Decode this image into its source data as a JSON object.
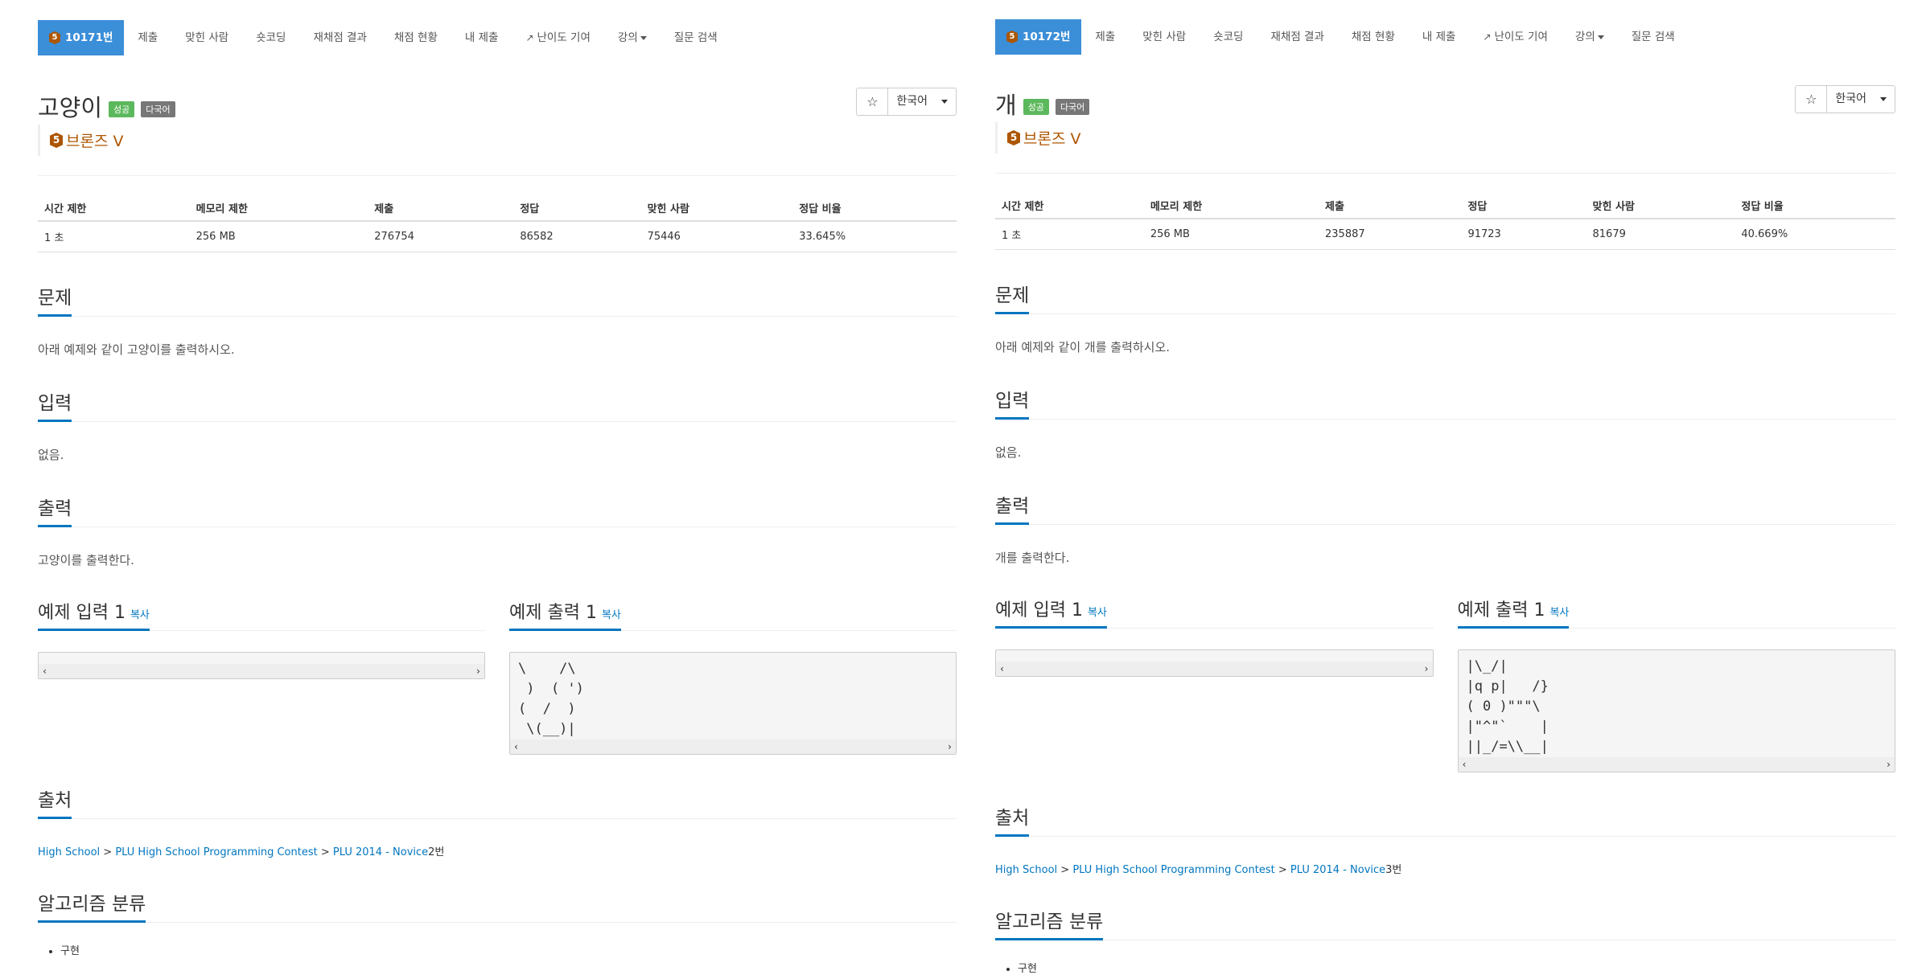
{
  "panels": [
    {
      "nav": {
        "problem_id": "10171번",
        "tier_digit": "5",
        "items": [
          "제출",
          "맞힌 사람",
          "숏코딩",
          "재채점 결과",
          "채점 현황",
          "내 제출",
          "난이도 기여",
          "강의",
          "질문 검색"
        ]
      },
      "title": "고양이",
      "badges": [
        "성공",
        "다국어"
      ],
      "star": "☆",
      "language": "한국어",
      "tier": "브론즈 V",
      "table": {
        "headers": [
          "시간 제한",
          "메모리 제한",
          "제출",
          "정답",
          "맞힌 사람",
          "정답 비율"
        ],
        "row": [
          "1 초",
          "256 MB",
          "276754",
          "86582",
          "75446",
          "33.645%"
        ]
      },
      "sections": {
        "problem_title": "문제",
        "problem_text": "아래 예제와 같이 고양이를 출력하시오.",
        "input_title": "입력",
        "input_text": "없음.",
        "output_title": "출력",
        "output_text": "고양이를 출력한다."
      },
      "sample_input": {
        "title": "예제 입력 1",
        "copy": "복사",
        "text": ""
      },
      "sample_output": {
        "title": "예제 출력 1",
        "copy": "복사",
        "text": "\\    /\\\n )  ( ')\n(  /  )\n \\(__)|"
      },
      "source": {
        "title": "출처",
        "links": [
          "High School",
          "PLU High School Programming Contest",
          "PLU 2014 - Novice"
        ],
        "suffix": "2번"
      },
      "algorithm": {
        "title": "알고리즘 분류",
        "items": [
          "구현"
        ]
      }
    },
    {
      "nav": {
        "problem_id": "10172번",
        "tier_digit": "5",
        "items": [
          "제출",
          "맞힌 사람",
          "숏코딩",
          "재채점 결과",
          "채점 현황",
          "내 제출",
          "난이도 기여",
          "강의",
          "질문 검색"
        ]
      },
      "title": "개",
      "badges": [
        "성공",
        "다국어"
      ],
      "star": "☆",
      "language": "한국어",
      "tier": "브론즈 V",
      "table": {
        "headers": [
          "시간 제한",
          "메모리 제한",
          "제출",
          "정답",
          "맞힌 사람",
          "정답 비율"
        ],
        "row": [
          "1 초",
          "256 MB",
          "235887",
          "91723",
          "81679",
          "40.669%"
        ]
      },
      "sections": {
        "problem_title": "문제",
        "problem_text": "아래 예제와 같이 개를 출력하시오.",
        "input_title": "입력",
        "input_text": "없음.",
        "output_title": "출력",
        "output_text": "개를 출력한다."
      },
      "sample_input": {
        "title": "예제 입력 1",
        "copy": "복사",
        "text": ""
      },
      "sample_output": {
        "title": "예제 출력 1",
        "copy": "복사",
        "text": "|\\_/|\n|q p|   /}\n( 0 )\"\"\"\\\n|\"^\"`    |\n||_/=\\\\__|"
      },
      "source": {
        "title": "출처",
        "links": [
          "High School",
          "PLU High School Programming Contest",
          "PLU 2014 - Novice"
        ],
        "suffix": "3번"
      },
      "algorithm": {
        "title": "알고리즘 분류",
        "items": [
          "구현"
        ]
      }
    }
  ]
}
